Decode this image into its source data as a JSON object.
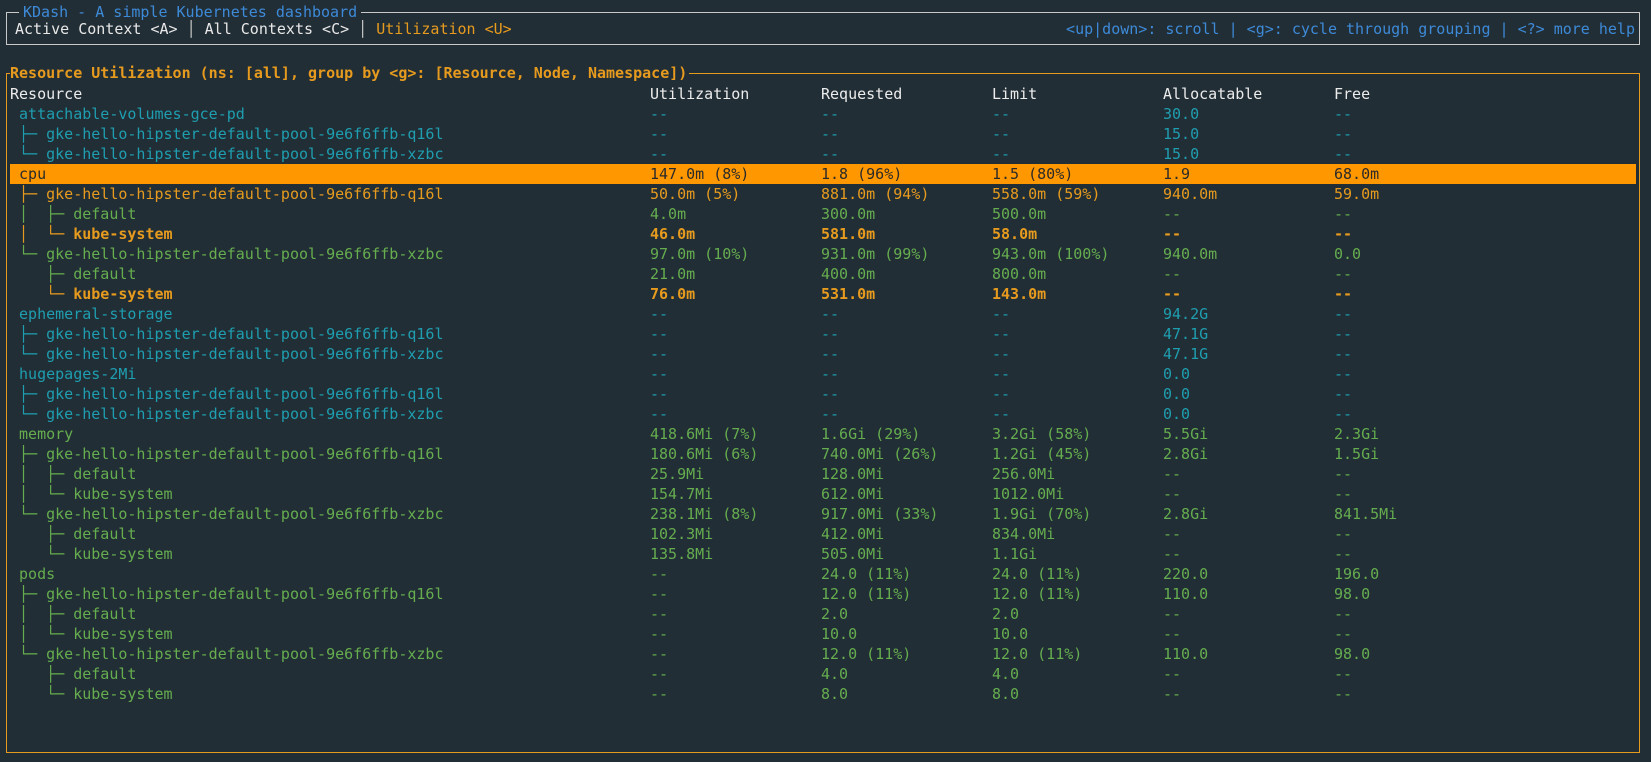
{
  "app": {
    "title": "KDash - A simple Kubernetes dashboard"
  },
  "tabs": [
    {
      "label": "Active Context <A>"
    },
    {
      "label": "All Contexts <C>"
    },
    {
      "label": "Utilization <U>"
    }
  ],
  "help": "<up|down>: scroll | <g>: cycle through grouping | <?> more help",
  "panel": {
    "title": "Resource Utilization (ns: [all], group by <g>: [Resource, Node, Namespace])"
  },
  "table": {
    "columns": [
      "Resource",
      "Utilization",
      "Requested",
      "Limit",
      "Allocatable",
      "Free"
    ],
    "rows": [
      {
        "style": "cyan",
        "cells": [
          " attachable-volumes-gce-pd",
          "--",
          "--",
          "--",
          "30.0",
          "--"
        ]
      },
      {
        "style": "cyan",
        "cells": [
          " ├─ gke-hello-hipster-default-pool-9e6f6ffb-q16l",
          "--",
          "--",
          "--",
          "15.0",
          "--"
        ]
      },
      {
        "style": "cyan",
        "cells": [
          " └─ gke-hello-hipster-default-pool-9e6f6ffb-xzbc",
          "--",
          "--",
          "--",
          "15.0",
          "--"
        ]
      },
      {
        "style": "selected",
        "cells": [
          " cpu",
          "147.0m (8%)",
          "1.8 (96%)",
          "1.5 (80%)",
          "1.9",
          "68.0m"
        ]
      },
      {
        "style": "orange-light",
        "cells": [
          " ├─ gke-hello-hipster-default-pool-9e6f6ffb-q16l",
          "50.0m (5%)",
          "881.0m (94%)",
          "558.0m (59%)",
          "940.0m",
          "59.0m"
        ]
      },
      {
        "style": "green",
        "cells": [
          " │  ├─ default",
          "4.0m",
          "300.0m",
          "500.0m",
          "--",
          "--"
        ]
      },
      {
        "style": "orange",
        "cells": [
          " │  └─ kube-system",
          "46.0m",
          "581.0m",
          "58.0m",
          "--",
          "--"
        ]
      },
      {
        "style": "green",
        "cells": [
          " └─ gke-hello-hipster-default-pool-9e6f6ffb-xzbc",
          "97.0m (10%)",
          "931.0m (99%)",
          "943.0m (100%)",
          "940.0m",
          "0.0"
        ]
      },
      {
        "style": "green",
        "cells": [
          "    ├─ default",
          "21.0m",
          "400.0m",
          "800.0m",
          "--",
          "--"
        ]
      },
      {
        "style": "orange",
        "cells": [
          "    └─ kube-system",
          "76.0m",
          "531.0m",
          "143.0m",
          "--",
          "--"
        ]
      },
      {
        "style": "cyan",
        "cells": [
          " ephemeral-storage",
          "--",
          "--",
          "--",
          "94.2G",
          "--"
        ]
      },
      {
        "style": "cyan",
        "cells": [
          " ├─ gke-hello-hipster-default-pool-9e6f6ffb-q16l",
          "--",
          "--",
          "--",
          "47.1G",
          "--"
        ]
      },
      {
        "style": "cyan",
        "cells": [
          " └─ gke-hello-hipster-default-pool-9e6f6ffb-xzbc",
          "--",
          "--",
          "--",
          "47.1G",
          "--"
        ]
      },
      {
        "style": "cyan",
        "cells": [
          " hugepages-2Mi",
          "--",
          "--",
          "--",
          "0.0",
          "--"
        ]
      },
      {
        "style": "cyan",
        "cells": [
          " ├─ gke-hello-hipster-default-pool-9e6f6ffb-q16l",
          "--",
          "--",
          "--",
          "0.0",
          "--"
        ]
      },
      {
        "style": "cyan",
        "cells": [
          " └─ gke-hello-hipster-default-pool-9e6f6ffb-xzbc",
          "--",
          "--",
          "--",
          "0.0",
          "--"
        ]
      },
      {
        "style": "green",
        "cells": [
          " memory",
          "418.6Mi (7%)",
          "1.6Gi (29%)",
          "3.2Gi (58%)",
          "5.5Gi",
          "2.3Gi"
        ]
      },
      {
        "style": "green",
        "cells": [
          " ├─ gke-hello-hipster-default-pool-9e6f6ffb-q16l",
          "180.6Mi (6%)",
          "740.0Mi (26%)",
          "1.2Gi (45%)",
          "2.8Gi",
          "1.5Gi"
        ]
      },
      {
        "style": "green",
        "cells": [
          " │  ├─ default",
          "25.9Mi",
          "128.0Mi",
          "256.0Mi",
          "--",
          "--"
        ]
      },
      {
        "style": "green",
        "cells": [
          " │  └─ kube-system",
          "154.7Mi",
          "612.0Mi",
          "1012.0Mi",
          "--",
          "--"
        ]
      },
      {
        "style": "green",
        "cells": [
          " └─ gke-hello-hipster-default-pool-9e6f6ffb-xzbc",
          "238.1Mi (8%)",
          "917.0Mi (33%)",
          "1.9Gi (70%)",
          "2.8Gi",
          "841.5Mi"
        ]
      },
      {
        "style": "green",
        "cells": [
          "    ├─ default",
          "102.3Mi",
          "412.0Mi",
          "834.0Mi",
          "--",
          "--"
        ]
      },
      {
        "style": "green",
        "cells": [
          "    └─ kube-system",
          "135.8Mi",
          "505.0Mi",
          "1.1Gi",
          "--",
          "--"
        ]
      },
      {
        "style": "green",
        "cells": [
          " pods",
          "--",
          "24.0 (11%)",
          "24.0 (11%)",
          "220.0",
          "196.0"
        ]
      },
      {
        "style": "green",
        "cells": [
          " ├─ gke-hello-hipster-default-pool-9e6f6ffb-q16l",
          "--",
          "12.0 (11%)",
          "12.0 (11%)",
          "110.0",
          "98.0"
        ]
      },
      {
        "style": "green",
        "cells": [
          " │  ├─ default",
          "--",
          "2.0",
          "2.0",
          "--",
          "--"
        ]
      },
      {
        "style": "green",
        "cells": [
          " │  └─ kube-system",
          "--",
          "10.0",
          "10.0",
          "--",
          "--"
        ]
      },
      {
        "style": "green",
        "cells": [
          " └─ gke-hello-hipster-default-pool-9e6f6ffb-xzbc",
          "--",
          "12.0 (11%)",
          "12.0 (11%)",
          "110.0",
          "98.0"
        ]
      },
      {
        "style": "green",
        "cells": [
          "    ├─ default",
          "--",
          "4.0",
          "4.0",
          "--",
          "--"
        ]
      },
      {
        "style": "green",
        "cells": [
          "    └─ kube-system",
          "--",
          "8.0",
          "8.0",
          "--",
          "--"
        ]
      }
    ]
  },
  "colors": {
    "background": "#222e35",
    "accent_orange": "#e79b1e",
    "selected_row": "#ff9800",
    "title_blue": "#3d8ad9",
    "cyan": "#1e9eb0",
    "green": "#65ad4f"
  }
}
